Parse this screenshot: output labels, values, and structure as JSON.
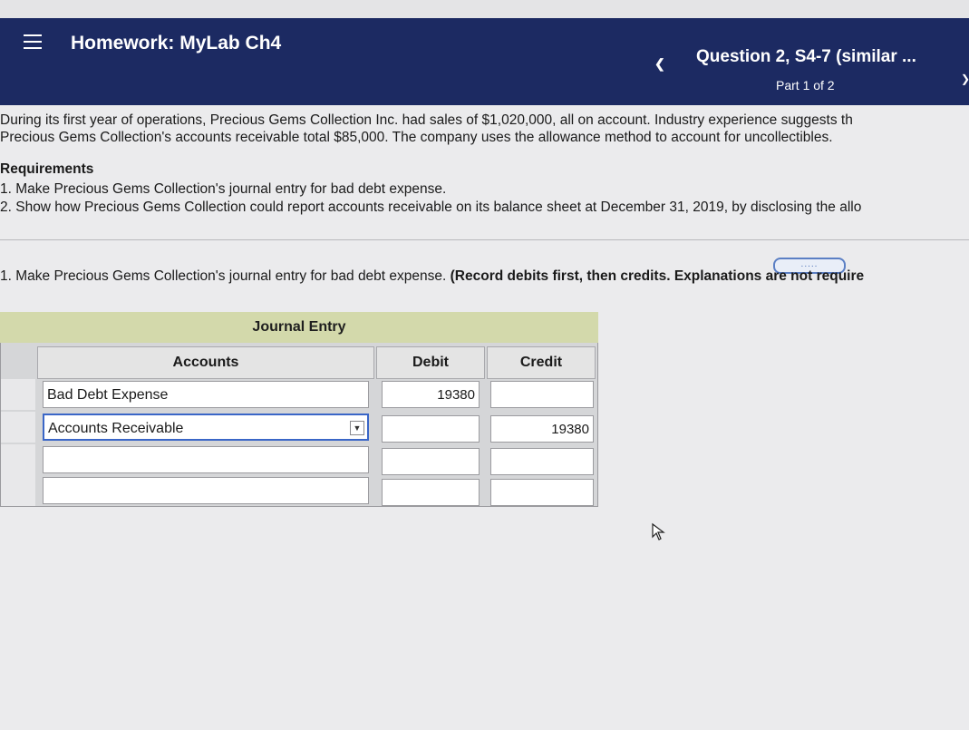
{
  "header": {
    "assignment_prefix": "Homework:",
    "assignment_name": "MyLab Ch4",
    "question_title": "Question 2, S4-7 (similar ...",
    "part_label": "Part 1 of 2",
    "menu_icon": "hamburger-icon",
    "prev_icon": "chevron-left-icon",
    "next_icon": "chevron-right-icon",
    "bg_color": "#1c2a62"
  },
  "problem": {
    "line1": "During its first year of operations, Precious Gems Collection Inc. had sales of $1,020,000, all on account. Industry experience suggests th",
    "line2": "Precious Gems Collection's accounts receivable total $85,000. The company uses the allowance method to account for uncollectibles."
  },
  "requirements": {
    "title": "Requirements",
    "items": [
      "1. Make Precious Gems Collection's journal entry for bad debt expense.",
      "2. Show how Precious Gems Collection could report accounts receivable on its balance sheet at December 31, 2019, by disclosing the allo"
    ]
  },
  "more_button": ".....",
  "instruction": {
    "text": "1. Make Precious Gems Collection's journal entry for bad debt expense. ",
    "bold": "(Record debits first, then credits. Explanations are not require"
  },
  "journal": {
    "title": "Journal Entry",
    "columns": {
      "accounts": "Accounts",
      "debit": "Debit",
      "credit": "Credit"
    },
    "rows": [
      {
        "account": "Bad Debt Expense",
        "debit": "19380",
        "credit": ""
      },
      {
        "account": "Accounts Receivable",
        "debit": "",
        "credit": "19380"
      },
      {
        "account": "",
        "debit": "",
        "credit": ""
      },
      {
        "account": "",
        "debit": "",
        "credit": ""
      }
    ],
    "header_color": "#d3d9ab"
  }
}
